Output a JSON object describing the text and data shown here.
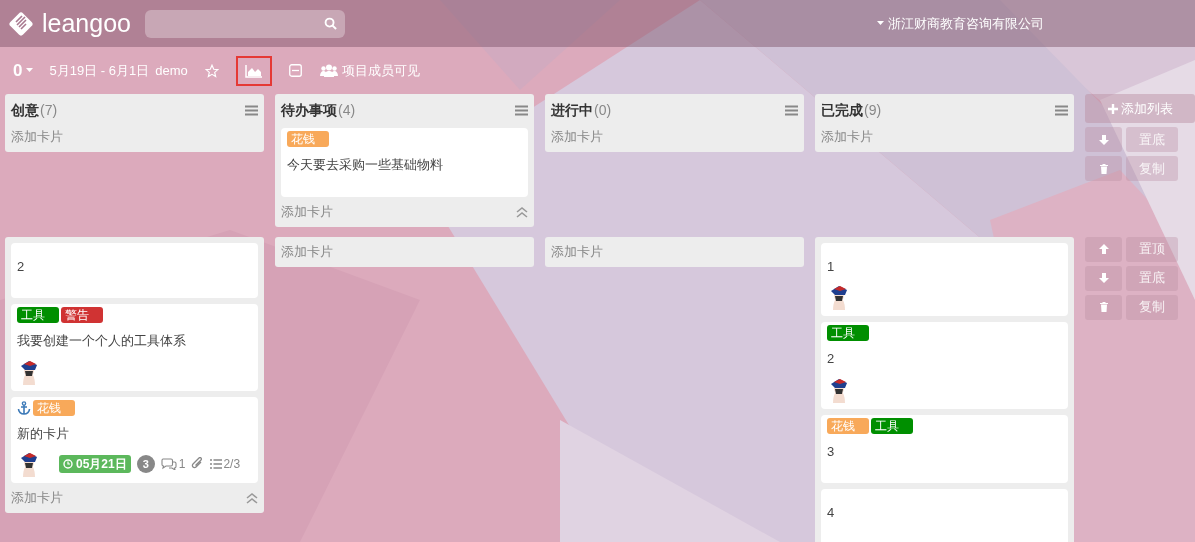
{
  "header": {
    "logo": "leangoo",
    "company": "浙江财商教育咨询有限公司"
  },
  "toolbar": {
    "number": "0",
    "dates": "5月19日 - 6月1日",
    "board": "demo",
    "tools": [
      {
        "kind": "star",
        "selected": false
      },
      {
        "kind": "chart",
        "selected": true
      },
      {
        "kind": "collapse",
        "selected": false
      }
    ],
    "visibility": "项目成员可见"
  },
  "lanes": [
    {
      "columns": [
        {
          "title": "创意",
          "count": "(7)",
          "add": "添加卡片",
          "collapse": false
        },
        {
          "title": "待办事项",
          "count": "(4)",
          "cards": [
            {
              "labels": [
                {
                  "text": "花钱",
                  "color": "#f8a95a"
                }
              ],
              "anchor": false,
              "title": "今天要去采购一些基础物料",
              "avatar": false
            }
          ],
          "add": "添加卡片",
          "collapse": true
        },
        {
          "title": "进行中",
          "count": "(0)",
          "add": "添加卡片",
          "collapse": false
        },
        {
          "title": "已完成",
          "count": "(9)",
          "add": "添加卡片",
          "collapse": false
        }
      ],
      "add_list": "添加列表",
      "actions": [
        {
          "kind": "down",
          "label": "置底"
        },
        {
          "kind": "trash",
          "label": "复制"
        }
      ]
    },
    {
      "columns": [
        {
          "cards": [
            {
              "anchor": false,
              "title": "2",
              "avatar": false
            },
            {
              "labels": [
                {
                  "text": "工具",
                  "color": "#008f00"
                },
                {
                  "text": "警告",
                  "color": "#d03333"
                }
              ],
              "anchor": false,
              "title": "我要创建一个个人的工具体系",
              "avatar": true
            },
            {
              "labels": [
                {
                  "text": "花钱",
                  "color": "#f8a95a"
                }
              ],
              "anchor": true,
              "title": "新的卡片",
              "avatar": true,
              "footer": [
                {
                  "kind": "due",
                  "text": "05月21日"
                },
                {
                  "kind": "count",
                  "text": "3"
                },
                {
                  "kind": "comments",
                  "text": "1"
                },
                {
                  "kind": "attachment"
                },
                {
                  "kind": "checklist",
                  "text": "2/3"
                }
              ]
            }
          ],
          "add": "添加卡片",
          "collapse": true
        },
        {
          "add": "添加卡片",
          "collapse": false
        },
        {
          "add": "添加卡片",
          "collapse": false
        },
        {
          "cards": [
            {
              "anchor": false,
              "title": "1",
              "avatar": true
            },
            {
              "labels": [
                {
                  "text": "工具",
                  "color": "#008f00"
                }
              ],
              "anchor": false,
              "title": "2",
              "avatar": true
            },
            {
              "labels": [
                {
                  "text": "花钱",
                  "color": "#f8a95a"
                },
                {
                  "text": "工具",
                  "color": "#008f00"
                }
              ],
              "anchor": false,
              "title": "3",
              "avatar": false
            },
            {
              "anchor": false,
              "title": "4",
              "avatar": false
            }
          ],
          "collapse": false
        }
      ],
      "actions": [
        {
          "kind": "up",
          "label": "置顶"
        },
        {
          "kind": "down",
          "label": "置底"
        },
        {
          "kind": "trash",
          "label": "复制"
        }
      ]
    }
  ]
}
